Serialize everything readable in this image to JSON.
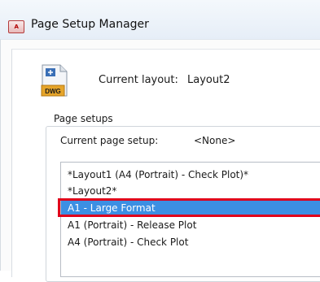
{
  "window": {
    "app_icon_text": "A",
    "title": "Page Setup Manager"
  },
  "current_layout": {
    "icon_text": "DWG",
    "label": "Current layout:",
    "value": "Layout2"
  },
  "page_setups": {
    "legend": "Page setups",
    "current_label": "Current page setup:",
    "current_value": "<None>",
    "items": [
      {
        "label": "*Layout1 (A4 (Portrait) - Check Plot)*"
      },
      {
        "label": "*Layout2*"
      },
      {
        "label": "A1 - Large Format",
        "selected": true
      },
      {
        "label": "A1 (Portrait) - Release Plot"
      },
      {
        "label": "A4 (Portrait) - Check Plot"
      }
    ]
  },
  "colors": {
    "selection": "#3c8fe3",
    "highlight": "#e0001b"
  }
}
